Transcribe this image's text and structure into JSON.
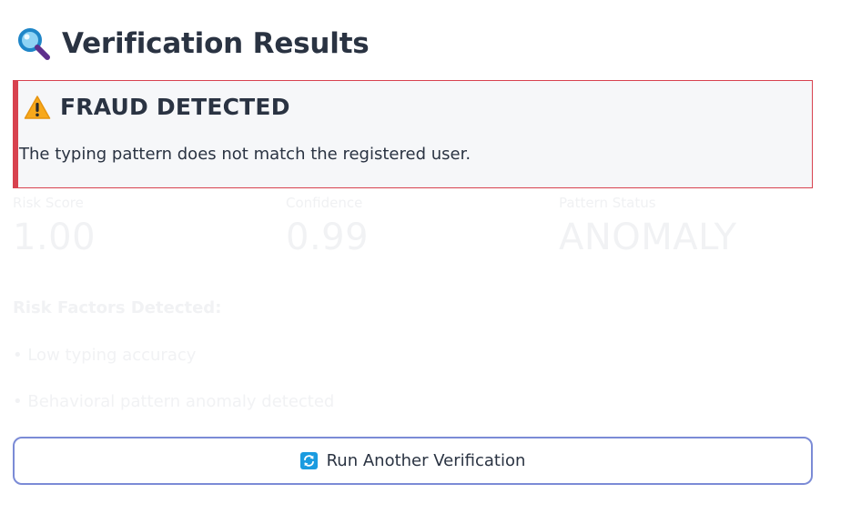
{
  "header": {
    "title": "Verification Results",
    "icon": "magnifying-glass-icon"
  },
  "alert": {
    "icon": "warning-icon",
    "heading": "FRAUD DETECTED",
    "message": "The typing pattern does not match the registered user.",
    "accent_color": "#d8424f"
  },
  "metrics": [
    {
      "label": "Risk Score",
      "value": "1.00"
    },
    {
      "label": "Confidence",
      "value": "0.99"
    },
    {
      "label": "Pattern Status",
      "value": "ANOMALY"
    }
  ],
  "risk_factors": {
    "title": "Risk Factors Detected:",
    "items": [
      "• Low typing accuracy",
      "• Behavioral pattern anomaly detected"
    ]
  },
  "actions": {
    "run_again_icon": "refresh-icon",
    "run_again_label": "Run Another Verification",
    "button_border_color": "#7b8bd6"
  }
}
